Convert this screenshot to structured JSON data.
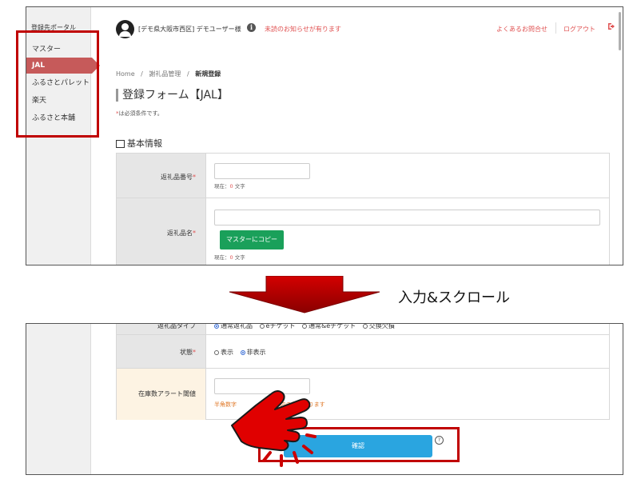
{
  "sidebar": {
    "title": "登録先ポータル",
    "items": [
      {
        "label": "マスター",
        "active": false
      },
      {
        "label": "JAL",
        "active": true
      },
      {
        "label": "ふるさとパレット",
        "active": false
      },
      {
        "label": "楽天",
        "active": false
      },
      {
        "label": "ふるさと本舗",
        "active": false
      }
    ]
  },
  "header": {
    "user": "[デモ県大阪市西区] デモユーザー様",
    "notice": "未読のお知らせが有ります",
    "faq": "よくあるお問合せ",
    "logout": "ログアウト"
  },
  "breadcrumb": {
    "home": "Home",
    "sep": "/",
    "parent": "謝礼品管理",
    "current": "新規登録"
  },
  "form": {
    "title": "登録フォーム【JAL】",
    "required_star": "*",
    "required_note": "は必須条件です。",
    "section": "基本情報",
    "rows": {
      "gift_number": {
        "label": "返礼品番号",
        "hint_prefix": "現在：",
        "hint_count": "0",
        "hint_suffix": "文字"
      },
      "gift_name": {
        "label": "返礼品名",
        "copy_button": "マスターにコピー",
        "hint_prefix": "現在：",
        "hint_count": "0",
        "hint_suffix": "文字"
      }
    }
  },
  "caption": "入力&スクロール",
  "form_bottom": {
    "gift_type": {
      "label": "返礼品タイプ",
      "options": [
        "通常返礼品",
        "eチケット",
        "通常&eチケット",
        "交換欠損"
      ],
      "selected": 0
    },
    "status": {
      "label": "状態",
      "options": [
        "表示",
        "非表示"
      ],
      "selected": 1
    },
    "stock_alert": {
      "label": "在庫数アラート閾値",
      "hint_left": "半角数字",
      "hint_right": "oxd内の値になります"
    },
    "confirm_button": "確認",
    "help_icon": "?"
  },
  "colors": {
    "accent_red": "#c00000",
    "sidebar_active": "#c65a5a",
    "link": "#e05252",
    "copy_button": "#1aa05a",
    "confirm_button": "#2aa5e0",
    "pointer": "#e00000"
  }
}
